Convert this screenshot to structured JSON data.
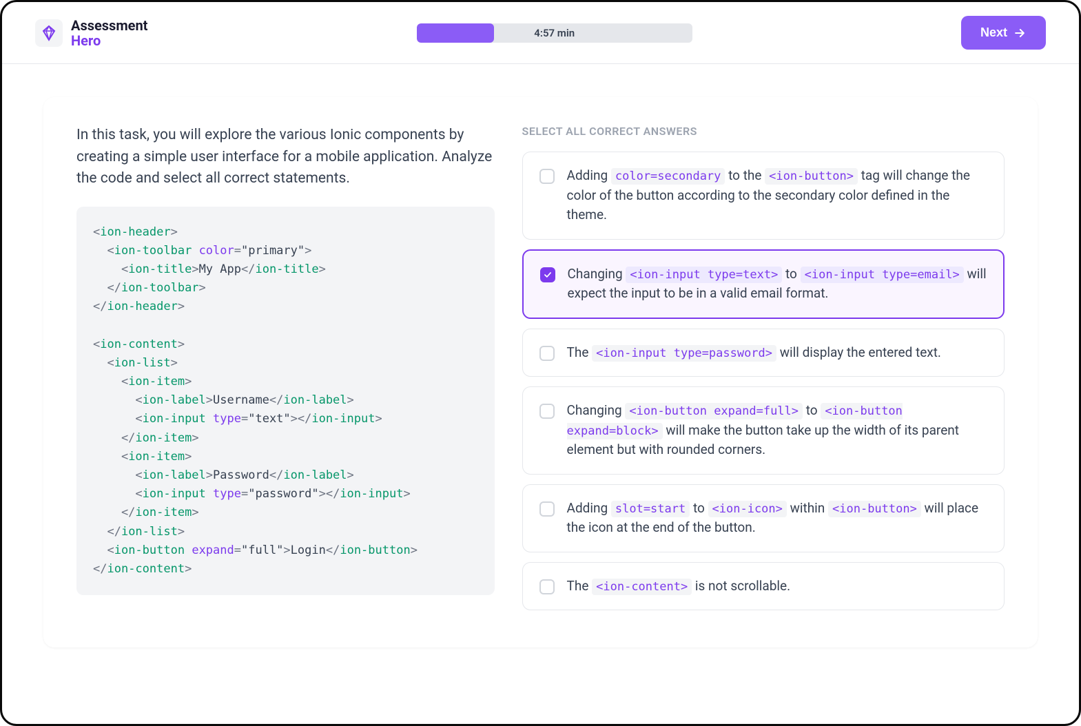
{
  "header": {
    "logo": {
      "line1": "Assessment",
      "line2": "Hero"
    },
    "progress": {
      "percent": 28,
      "label": "4:57 min"
    },
    "next_label": "Next"
  },
  "task": {
    "description": "In this task, you will explore the various Ionic components by creating a simple user interface for a mobile application. Analyze the code and select all correct statements.",
    "code_tokens": [
      {
        "t": "<",
        "c": "punct"
      },
      {
        "t": "ion-header",
        "c": "tag"
      },
      {
        "t": ">\n",
        "c": "punct"
      },
      {
        "t": "  <",
        "c": "punct"
      },
      {
        "t": "ion-toolbar",
        "c": "tag"
      },
      {
        "t": " ",
        "c": "punct"
      },
      {
        "t": "color",
        "c": "attr"
      },
      {
        "t": "=",
        "c": "punct"
      },
      {
        "t": "\"primary\"",
        "c": "str"
      },
      {
        "t": ">\n",
        "c": "punct"
      },
      {
        "t": "    <",
        "c": "punct"
      },
      {
        "t": "ion-title",
        "c": "tag"
      },
      {
        "t": ">",
        "c": "punct"
      },
      {
        "t": "My App",
        "c": "str"
      },
      {
        "t": "</",
        "c": "punct"
      },
      {
        "t": "ion-title",
        "c": "tag"
      },
      {
        "t": ">\n",
        "c": "punct"
      },
      {
        "t": "  </",
        "c": "punct"
      },
      {
        "t": "ion-toolbar",
        "c": "tag"
      },
      {
        "t": ">\n",
        "c": "punct"
      },
      {
        "t": "</",
        "c": "punct"
      },
      {
        "t": "ion-header",
        "c": "tag"
      },
      {
        "t": ">\n\n",
        "c": "punct"
      },
      {
        "t": "<",
        "c": "punct"
      },
      {
        "t": "ion-content",
        "c": "tag"
      },
      {
        "t": ">\n",
        "c": "punct"
      },
      {
        "t": "  <",
        "c": "punct"
      },
      {
        "t": "ion-list",
        "c": "tag"
      },
      {
        "t": ">\n",
        "c": "punct"
      },
      {
        "t": "    <",
        "c": "punct"
      },
      {
        "t": "ion-item",
        "c": "tag"
      },
      {
        "t": ">\n",
        "c": "punct"
      },
      {
        "t": "      <",
        "c": "punct"
      },
      {
        "t": "ion-label",
        "c": "tag"
      },
      {
        "t": ">",
        "c": "punct"
      },
      {
        "t": "Username",
        "c": "str"
      },
      {
        "t": "</",
        "c": "punct"
      },
      {
        "t": "ion-label",
        "c": "tag"
      },
      {
        "t": ">\n",
        "c": "punct"
      },
      {
        "t": "      <",
        "c": "punct"
      },
      {
        "t": "ion-input",
        "c": "tag"
      },
      {
        "t": " ",
        "c": "punct"
      },
      {
        "t": "type",
        "c": "attr"
      },
      {
        "t": "=",
        "c": "punct"
      },
      {
        "t": "\"text\"",
        "c": "str"
      },
      {
        "t": "></",
        "c": "punct"
      },
      {
        "t": "ion-input",
        "c": "tag"
      },
      {
        "t": ">\n",
        "c": "punct"
      },
      {
        "t": "    </",
        "c": "punct"
      },
      {
        "t": "ion-item",
        "c": "tag"
      },
      {
        "t": ">\n",
        "c": "punct"
      },
      {
        "t": "    <",
        "c": "punct"
      },
      {
        "t": "ion-item",
        "c": "tag"
      },
      {
        "t": ">\n",
        "c": "punct"
      },
      {
        "t": "      <",
        "c": "punct"
      },
      {
        "t": "ion-label",
        "c": "tag"
      },
      {
        "t": ">",
        "c": "punct"
      },
      {
        "t": "Password",
        "c": "str"
      },
      {
        "t": "</",
        "c": "punct"
      },
      {
        "t": "ion-label",
        "c": "tag"
      },
      {
        "t": ">\n",
        "c": "punct"
      },
      {
        "t": "      <",
        "c": "punct"
      },
      {
        "t": "ion-input",
        "c": "tag"
      },
      {
        "t": " ",
        "c": "punct"
      },
      {
        "t": "type",
        "c": "attr"
      },
      {
        "t": "=",
        "c": "punct"
      },
      {
        "t": "\"password\"",
        "c": "str"
      },
      {
        "t": "></",
        "c": "punct"
      },
      {
        "t": "ion-input",
        "c": "tag"
      },
      {
        "t": ">\n",
        "c": "punct"
      },
      {
        "t": "    </",
        "c": "punct"
      },
      {
        "t": "ion-item",
        "c": "tag"
      },
      {
        "t": ">\n",
        "c": "punct"
      },
      {
        "t": "  </",
        "c": "punct"
      },
      {
        "t": "ion-list",
        "c": "tag"
      },
      {
        "t": ">\n",
        "c": "punct"
      },
      {
        "t": "  <",
        "c": "punct"
      },
      {
        "t": "ion-button",
        "c": "tag"
      },
      {
        "t": " ",
        "c": "punct"
      },
      {
        "t": "expand",
        "c": "attr"
      },
      {
        "t": "=",
        "c": "punct"
      },
      {
        "t": "\"full\"",
        "c": "str"
      },
      {
        "t": ">",
        "c": "punct"
      },
      {
        "t": "Login",
        "c": "str"
      },
      {
        "t": "</",
        "c": "punct"
      },
      {
        "t": "ion-button",
        "c": "tag"
      },
      {
        "t": ">\n",
        "c": "punct"
      },
      {
        "t": "</",
        "c": "punct"
      },
      {
        "t": "ion-content",
        "c": "tag"
      },
      {
        "t": ">",
        "c": "punct"
      }
    ]
  },
  "answers": {
    "label": "SELECT ALL CORRECT ANSWERS",
    "options": [
      {
        "checked": false,
        "parts": [
          {
            "text": "Adding "
          },
          {
            "code": "color=secondary"
          },
          {
            "text": " to the "
          },
          {
            "code": "<ion-button>"
          },
          {
            "text": " tag will change the color of the button according to the secondary color defined in the theme."
          }
        ]
      },
      {
        "checked": true,
        "parts": [
          {
            "text": "Changing "
          },
          {
            "code": "<ion-input type=text>"
          },
          {
            "text": " to "
          },
          {
            "code": "<ion-input type=email>"
          },
          {
            "text": " will expect the input to be in a valid email format."
          }
        ]
      },
      {
        "checked": false,
        "parts": [
          {
            "text": "The "
          },
          {
            "code": "<ion-input type=password>"
          },
          {
            "text": " will display the entered text."
          }
        ]
      },
      {
        "checked": false,
        "parts": [
          {
            "text": "Changing "
          },
          {
            "code": "<ion-button expand=full>"
          },
          {
            "text": " to "
          },
          {
            "code": "<ion-button expand=block>"
          },
          {
            "text": " will make the button take up the width of its parent element but with rounded corners."
          }
        ]
      },
      {
        "checked": false,
        "parts": [
          {
            "text": "Adding "
          },
          {
            "code": "slot=start"
          },
          {
            "text": " to "
          },
          {
            "code": "<ion-icon>"
          },
          {
            "text": " within "
          },
          {
            "code": "<ion-button>"
          },
          {
            "text": " will place the icon at the end of the button."
          }
        ]
      },
      {
        "checked": false,
        "parts": [
          {
            "text": "The "
          },
          {
            "code": "<ion-content>"
          },
          {
            "text": " is not scrollable."
          }
        ]
      }
    ]
  }
}
